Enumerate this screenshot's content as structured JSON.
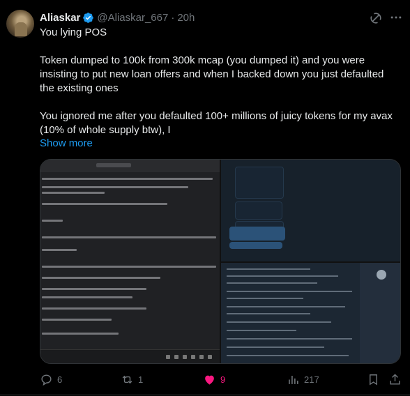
{
  "tweet": {
    "display_name": "Aliaskar",
    "handle": "@Aliaskar_667",
    "separator": "·",
    "time": "20h",
    "lines": [
      "You lying POS",
      "Token dumped to 100k from 300k mcap (you dumped it) and you were insisting to put new loan offers and when I backed down you just defaulted the existing ones",
      "You ignored me after you defaulted 100+ millions of juicy tokens for my avax (10% of whole supply btw), I"
    ],
    "show_more": "Show more"
  },
  "actions": {
    "replies": "6",
    "reposts": "1",
    "likes": "9",
    "views": "217"
  },
  "colors": {
    "accent": "#1d9bf0",
    "like": "#f91880",
    "muted": "#71767b",
    "verified": "#1d9bf0"
  },
  "icons": [
    "verified-badge-icon",
    "grok-icon",
    "more-icon",
    "reply-icon",
    "repost-icon",
    "heart-icon",
    "views-icon",
    "bookmark-icon",
    "share-icon"
  ]
}
